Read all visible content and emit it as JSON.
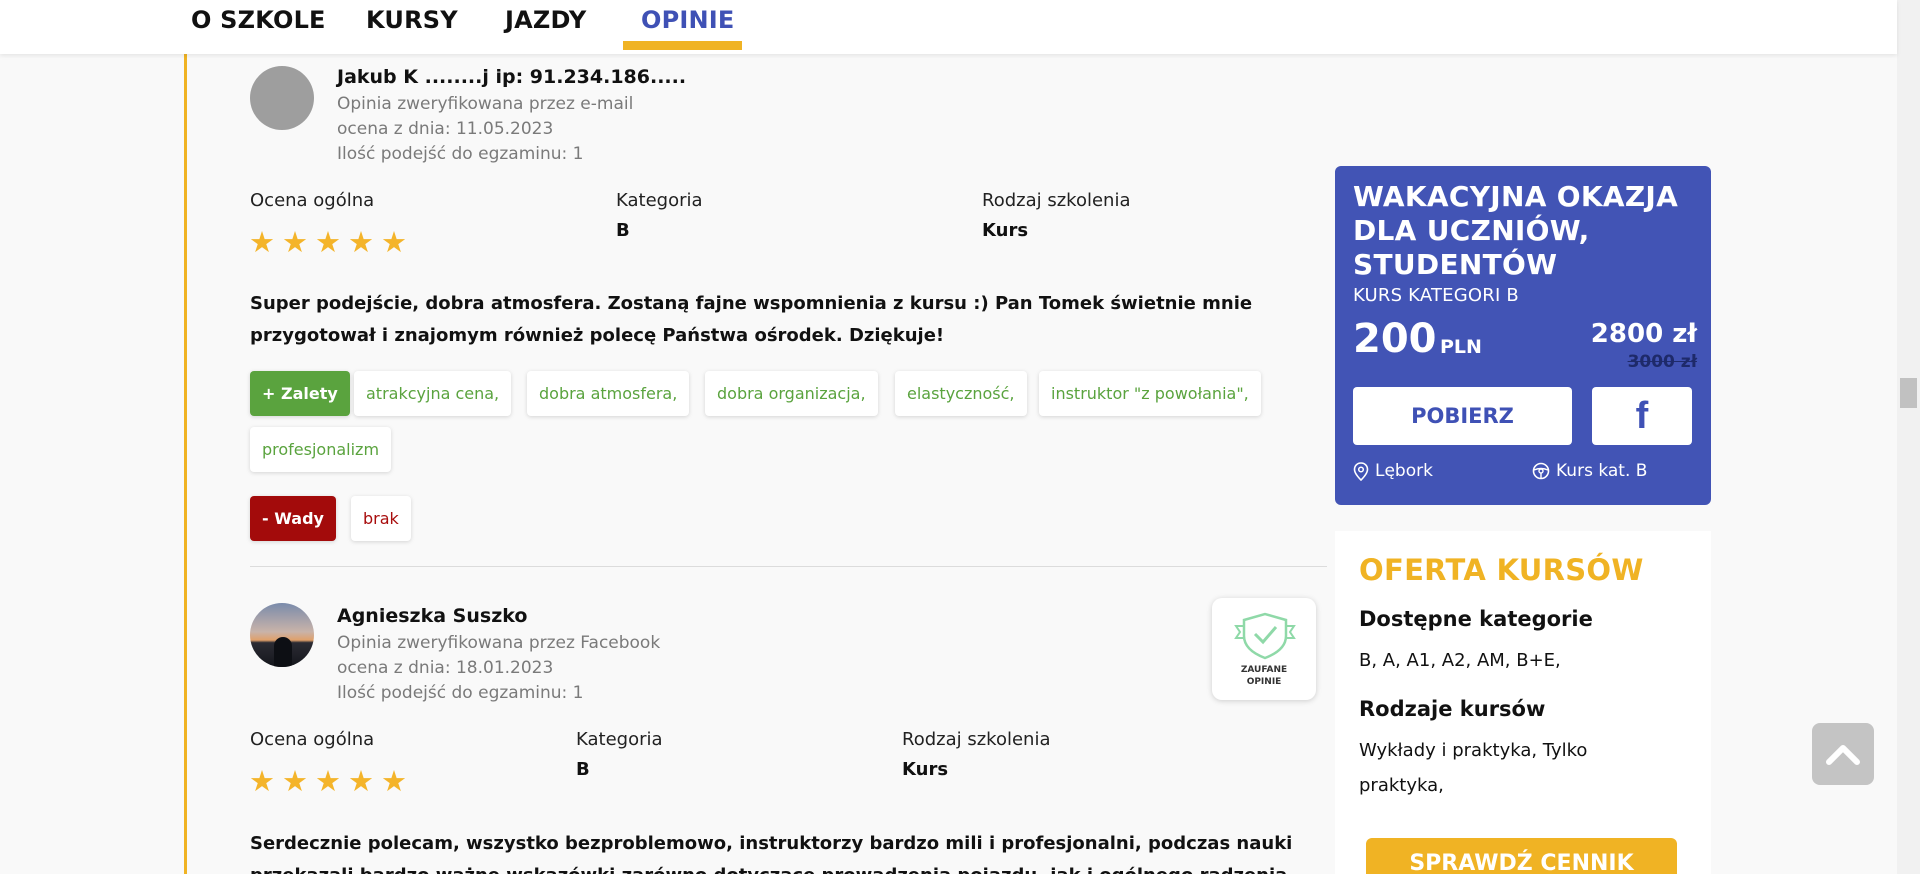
{
  "nav": {
    "tabs": [
      {
        "label": "O SZKOLE"
      },
      {
        "label": "KURSY"
      },
      {
        "label": "JAZDY"
      },
      {
        "label": "OPINIE"
      }
    ],
    "active_tab": "OPINIE"
  },
  "reviews": [
    {
      "name": "Jakub K ........j ip: 91.234.186.....",
      "verified": "Opinia zweryfikowana przez e-mail",
      "date": "ocena z dnia: 11.05.2023",
      "attempts": "Ilość podejść do egzaminu: 1",
      "overall_label": "Ocena ogólna",
      "rating": 5,
      "category_label": "Kategoria",
      "category": "B",
      "training_label": "Rodzaj szkolenia",
      "training": "Kurs",
      "text": "Super podejście, dobra atmosfera. Zostaną fajne wspomnienia z kursu :) Pan Tomek świetnie mnie przygotował i znajomym również polecę Państwa ośrodek. Dziękuje!",
      "pros_label": "+ Zalety",
      "pros": [
        "atrakcyjna cena,",
        "dobra atmosfera,",
        "dobra organizacja,",
        "elastyczność,",
        "instruktor \"z powołania\",",
        "profesjonalizm"
      ],
      "cons_label": "- Wady",
      "cons": [
        "brak"
      ]
    },
    {
      "name": "Agnieszka Suszko",
      "verified": "Opinia zweryfikowana przez Facebook",
      "date": "ocena z dnia: 18.01.2023",
      "attempts": "Ilość podejść do egzaminu: 1",
      "overall_label": "Ocena ogólna",
      "rating": 5,
      "category_label": "Kategoria",
      "category": "B",
      "training_label": "Rodzaj szkolenia",
      "training": "Kurs",
      "text_line1": "Serdecznie polecam, wszystko bezproblemowo, instruktorzy bardzo mili i profesjonalni, podczas nauki",
      "text_line2": "przekazali bardzo ważne wskazówki zarówno dotyczące prowadzenia pojazdu, jak i ogólnego radzenia",
      "badge_line1": "ZAUFANE",
      "badge_line2": "OPINIE"
    }
  ],
  "promo": {
    "title": "WAKACYJNA OKAZJA DLA UCZNIÓW, STUDENTÓW",
    "subtitle": "KURS KATEGORI B",
    "price": "200",
    "currency": "PLN",
    "old_price": "2800 zł",
    "strike_price": "3000 zł",
    "download_label": "POBIERZ",
    "fb_label": "f",
    "location": "Lębork",
    "course": "Kurs kat. B",
    "bg_color": "#4254b5"
  },
  "offer": {
    "title": "OFERTA KURSÓW",
    "categories_heading": "Dostępne kategorie",
    "categories": "B, A, A1, A2, AM, B+E,",
    "types_heading": "Rodzaje kursów",
    "types": "Wykłady i praktyka, Tylko praktyka,",
    "cta_label": "SPRAWDŹ CENNIK",
    "accent_color": "#f0b324"
  },
  "icons": {
    "star": "★",
    "location": "location-pin-icon",
    "steering": "steering-wheel-icon",
    "back_to_top": "chevron-up-icon"
  }
}
